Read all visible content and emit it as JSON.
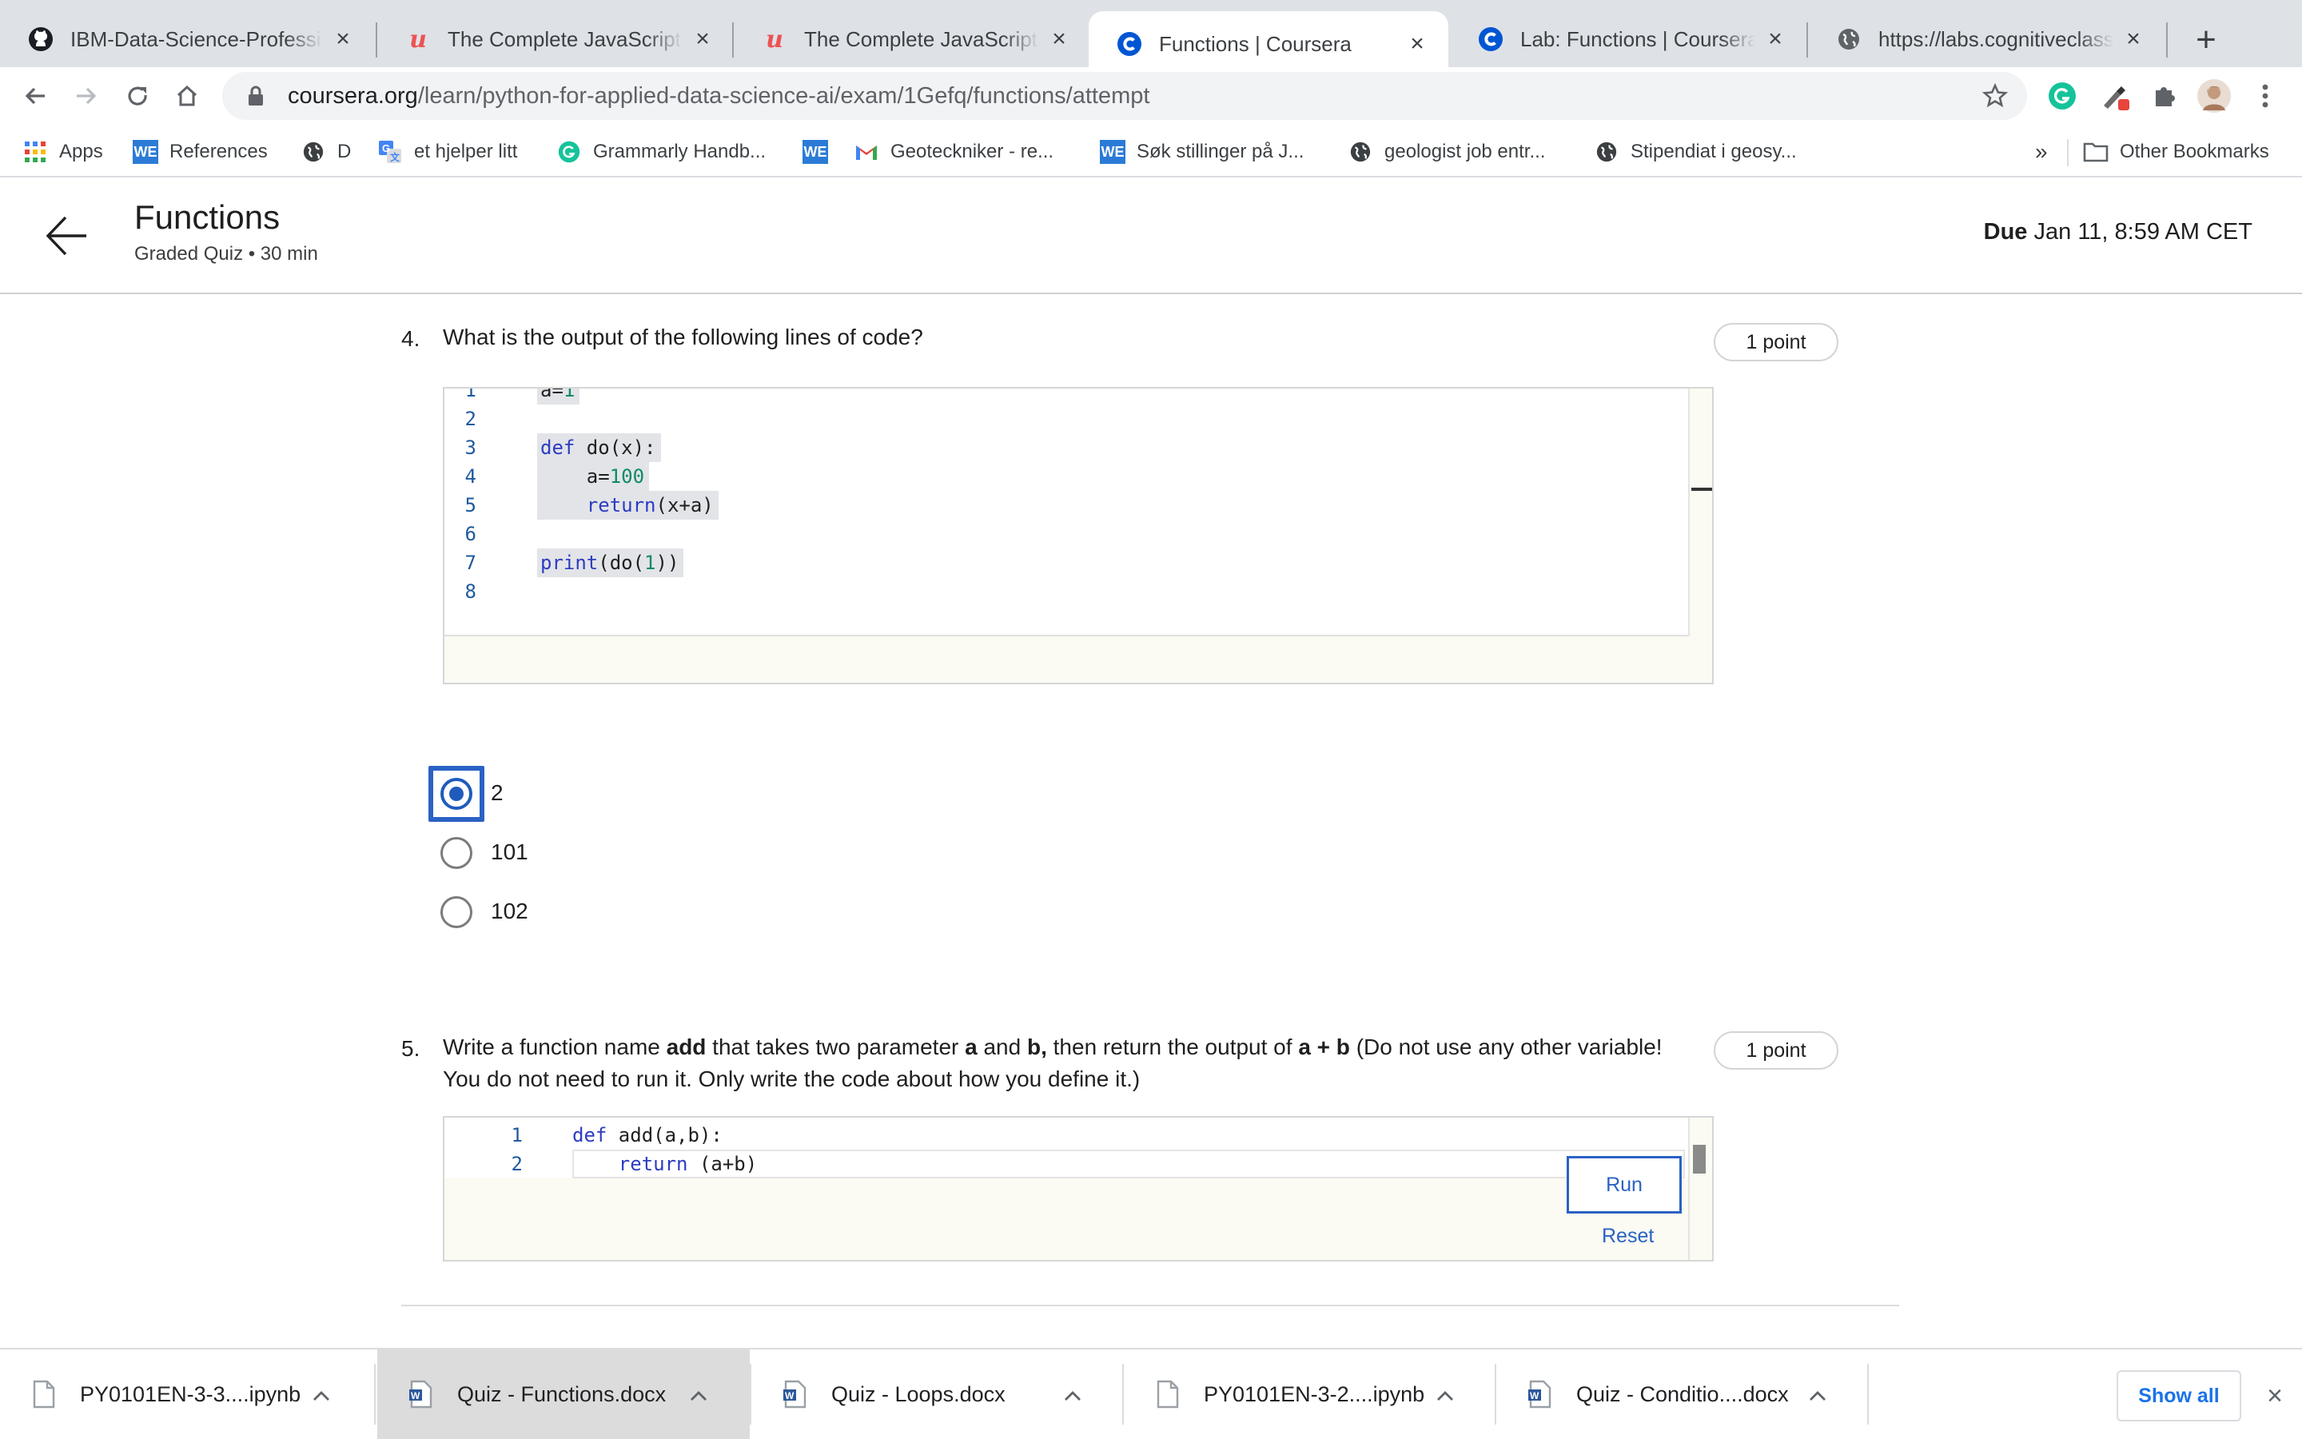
{
  "tabs": [
    {
      "title": "IBM-Data-Science-Professional",
      "icon": "github-icon"
    },
    {
      "title": "The Complete JavaScript Course",
      "icon": "udemy-icon"
    },
    {
      "title": "The Complete JavaScript Course",
      "icon": "udemy-icon"
    },
    {
      "title": "Functions | Coursera",
      "icon": "coursera-icon",
      "active": true
    },
    {
      "title": "Lab: Functions | Coursera",
      "icon": "coursera-icon"
    },
    {
      "title": "https://labs.cognitiveclass.ai",
      "icon": "globe-icon"
    }
  ],
  "address": {
    "host": "coursera.org",
    "path": "/learn/python-for-applied-data-science-ai/exam/1Gefq/functions/attempt"
  },
  "bookmarks": [
    {
      "label": "Apps",
      "icon": "apps-grid-icon"
    },
    {
      "label": "References",
      "icon": "we-icon"
    },
    {
      "label": "D",
      "icon": "globe-icon"
    },
    {
      "label": "et hjelper litt",
      "icon": "translate-icon"
    },
    {
      "label": "Grammarly Handb...",
      "icon": "grammarly-icon"
    },
    {
      "label": "",
      "icon": "we-icon"
    },
    {
      "label": "Geoteckniker - re...",
      "icon": "gmail-icon"
    },
    {
      "label": "Søk stillinger på J...",
      "icon": "we-icon"
    },
    {
      "label": "geologist job entr...",
      "icon": "globe-icon"
    },
    {
      "label": "Stipendiat i geosy...",
      "icon": "globe-icon"
    }
  ],
  "bookmarks_overflow": "»",
  "other_bookmarks": "Other Bookmarks",
  "header": {
    "title": "Functions",
    "subtitle": "Graded Quiz • 30 min",
    "due_label": "Due",
    "due_value": "Jan 11, 8:59 AM CET"
  },
  "q4": {
    "number": "4.",
    "text": "What is the output of the following lines of code?",
    "points": "1 point",
    "code": [
      {
        "n": "1",
        "text": "a=1"
      },
      {
        "n": "2",
        "text": ""
      },
      {
        "n": "3",
        "text": "def do(x):"
      },
      {
        "n": "4",
        "text": "    a=100"
      },
      {
        "n": "5",
        "text": "    return(x+a)"
      },
      {
        "n": "6",
        "text": ""
      },
      {
        "n": "7",
        "text": "print(do(1))"
      },
      {
        "n": "8",
        "text": ""
      }
    ],
    "options": [
      {
        "label": "2",
        "selected": true
      },
      {
        "label": "101",
        "selected": false
      },
      {
        "label": "102",
        "selected": false
      }
    ]
  },
  "q5": {
    "number": "5.",
    "text_parts": [
      {
        "t": "Write a function name ",
        "b": false
      },
      {
        "t": "add",
        "b": true
      },
      {
        "t": " that takes two parameter ",
        "b": false
      },
      {
        "t": "a",
        "b": true
      },
      {
        "t": " and ",
        "b": false
      },
      {
        "t": "b,",
        "b": true
      },
      {
        "t": " then return the output of  ",
        "b": false
      },
      {
        "t": "a + b",
        "b": true
      },
      {
        "t": " (Do not use any other variable! You do not need to run it. Only write the code about how you define it.)",
        "b": false
      }
    ],
    "points": "1 point",
    "code": [
      {
        "n": "1",
        "text": "def add(a,b):"
      },
      {
        "n": "2",
        "text": "    return (a+b)"
      }
    ],
    "run_label": "Run",
    "reset_label": "Reset"
  },
  "downloads": [
    {
      "name": "PY0101EN-3-3....ipynb",
      "type": "file"
    },
    {
      "name": "Quiz - Functions.docx",
      "type": "word"
    },
    {
      "name": "Quiz - Loops.docx",
      "type": "word"
    },
    {
      "name": "PY0101EN-3-2....ipynb",
      "type": "file"
    },
    {
      "name": "Quiz - Conditio....docx",
      "type": "word"
    }
  ],
  "show_all": "Show all",
  "colors": {
    "accent": "#2a62c4",
    "code_bg": "#fbfaf3",
    "keyword": "#2d3cc2",
    "number": "#0f8a66"
  }
}
